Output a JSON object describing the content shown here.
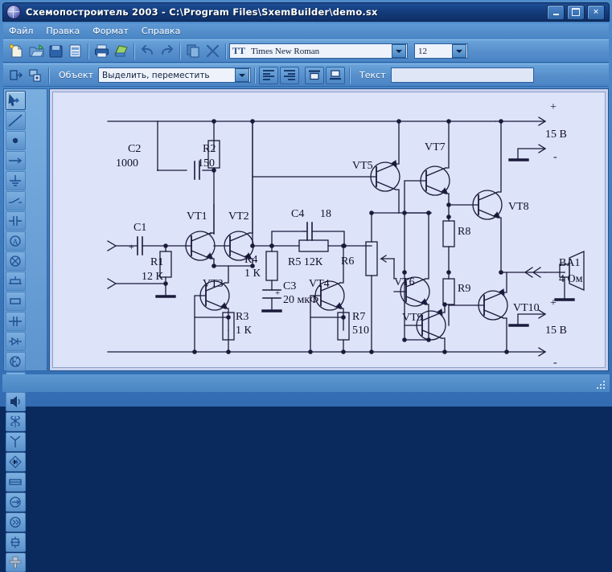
{
  "window": {
    "title": "Схемопостроитель 2003 - C:\\Program Files\\SxemBuilder\\demo.sx",
    "app_icon": "globe-icon",
    "controls": {
      "minimize": "minimize-button",
      "maximize": "maximize-button",
      "close": "×"
    }
  },
  "menu": {
    "items": [
      "Файл",
      "Правка",
      "Формат",
      "Справка"
    ]
  },
  "toolbar1": {
    "buttons": [
      {
        "name": "new-document-button"
      },
      {
        "name": "open-folder-button"
      },
      {
        "name": "save-button"
      },
      {
        "name": "page-setup-button"
      },
      {
        "name": "print-button"
      },
      {
        "name": "print-preview-button"
      },
      {
        "name": "undo-button"
      },
      {
        "name": "redo-button"
      },
      {
        "name": "copy-button"
      },
      {
        "name": "delete-button"
      }
    ],
    "font_name": "Times New Roman",
    "font_name_icon": "TT",
    "font_size": "12"
  },
  "toolbar2": {
    "object_label": "Объект",
    "object_value": "Выделить, переместить",
    "text_label": "Текст",
    "text_value": "",
    "align_buttons": [
      "align-left-button",
      "align-right-button",
      "align-top-button",
      "align-bottom-button"
    ],
    "left_buttons": [
      "export-button",
      "properties-button"
    ]
  },
  "palette": {
    "tools": [
      "select-move-tool",
      "line-tool",
      "node-dot-tool",
      "arrow-tool",
      "ground-tool",
      "switch-tool",
      "capacitor-tool",
      "ammeter-tool",
      "lamp-tool",
      "fuse-tool",
      "resistor-tool",
      "capacitor2-tool",
      "diode-tool",
      "transistor-tool",
      "inductor-tool",
      "speaker-tool",
      "transformer-tool",
      "antenna-tool",
      "bridge-rectifier-tool",
      "battery-tool",
      "current-source-tool",
      "amplifier-tool",
      "variable-capacitor-tool",
      "motor-tool"
    ],
    "selected_index": 0
  },
  "schematic": {
    "components": [
      {
        "ref": "C1",
        "value": ""
      },
      {
        "ref": "C2",
        "value": "1000"
      },
      {
        "ref": "C3",
        "value": "20 мкФ"
      },
      {
        "ref": "C4",
        "value": "18"
      },
      {
        "ref": "R1",
        "value": "12 К"
      },
      {
        "ref": "R2",
        "value": "150"
      },
      {
        "ref": "R3",
        "value": "1 К"
      },
      {
        "ref": "R4",
        "value": "1 К"
      },
      {
        "ref": "R5",
        "value": "12К"
      },
      {
        "ref": "R6",
        "value": ""
      },
      {
        "ref": "R7",
        "value": "510"
      },
      {
        "ref": "R8",
        "value": ""
      },
      {
        "ref": "R9",
        "value": ""
      },
      {
        "ref": "VT1",
        "value": ""
      },
      {
        "ref": "VT2",
        "value": ""
      },
      {
        "ref": "VT3",
        "value": ""
      },
      {
        "ref": "VT4",
        "value": ""
      },
      {
        "ref": "VT5",
        "value": ""
      },
      {
        "ref": "VT6",
        "value": ""
      },
      {
        "ref": "VT7",
        "value": ""
      },
      {
        "ref": "VT8",
        "value": ""
      },
      {
        "ref": "VT9",
        "value": ""
      },
      {
        "ref": "VT10",
        "value": ""
      },
      {
        "ref": "BA1",
        "value": "4 Ом"
      }
    ],
    "labels": {
      "c1": "C1",
      "c2": "C2",
      "c2_val": "1000",
      "c3": "C3",
      "c3_val": "20 мкФ",
      "c4": "C4",
      "c4_val": "18",
      "r1": "R1",
      "r1_val": "12 К",
      "r2": "R2",
      "r2_val": "150",
      "r3": "R3",
      "r3_val": "1 К",
      "r4": "R4",
      "r4_val": "1 К",
      "r5": "R5 12К",
      "r6": "R6",
      "r7": "R7",
      "r7_val": "510",
      "r8": "R8",
      "r9": "R9",
      "vt1": "VT1",
      "vt2": "VT2",
      "vt3": "VT3",
      "vt4": "VT4",
      "vt5": "VT5",
      "vt6": "VT6",
      "vt7": "VT7",
      "vt8": "VT8",
      "vt9": "VT9",
      "vt10": "VT10",
      "ba1": "BA1",
      "ba1_val": "4 Ом",
      "supply_top_plus": "+",
      "supply_top_volt": "15 В",
      "supply_top_minus": "-",
      "supply_bot_plus": "+",
      "supply_bot_volt": "15 В",
      "supply_bot_minus": "-",
      "plus_c1": "+",
      "plus_c3": "+"
    }
  },
  "colors": {
    "titlebar": "#153f80",
    "toolbar": "#5790cc",
    "canvas_bg": "#dde3f8",
    "wire": "#1a1a3a",
    "accent": "#2b5f9e"
  },
  "statusbar": {
    "text": ""
  }
}
